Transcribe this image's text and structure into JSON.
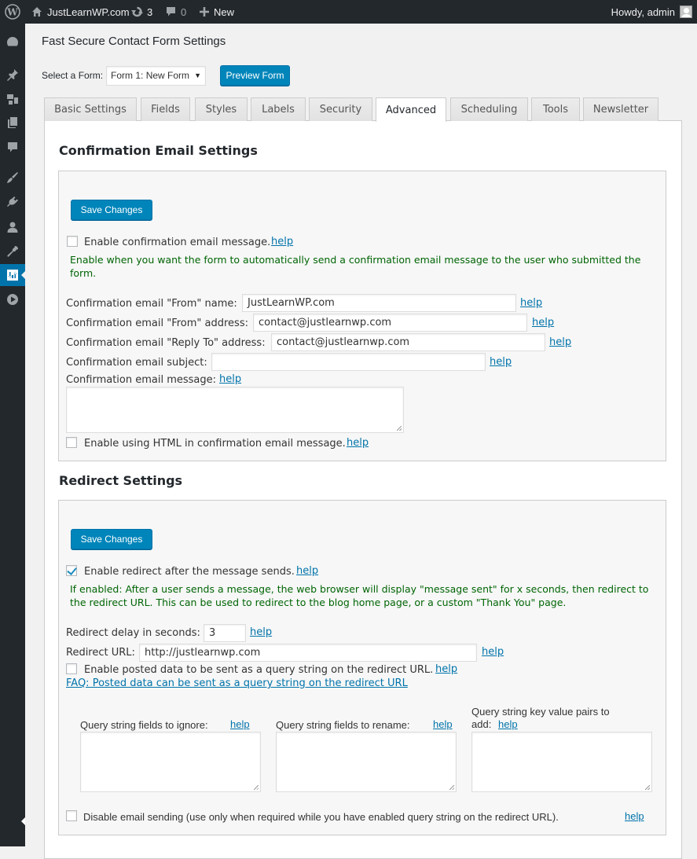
{
  "admin_bar": {
    "site_name": "JustLearnWP.com",
    "updates_count": "3",
    "comments_count": "0",
    "new_label": "New",
    "howdy": "Howdy, admin"
  },
  "sidebar": {
    "items": [
      {
        "icon": "dashboard-icon"
      },
      {
        "icon": "posts-pin-icon"
      },
      {
        "icon": "media-icon"
      },
      {
        "icon": "pages-icon"
      },
      {
        "icon": "comments-icon"
      },
      {
        "icon": "appearance-brush-icon"
      },
      {
        "icon": "plugins-icon"
      },
      {
        "icon": "users-icon"
      },
      {
        "icon": "tools-wrench-icon"
      },
      {
        "icon": "settings-sliders-icon",
        "active": true
      },
      {
        "icon": "play-circle-icon"
      }
    ]
  },
  "page": {
    "title": "Fast Secure Contact Form Settings",
    "select_label": "Select a Form:",
    "select_value": "Form 1: New Form",
    "preview_button": "Preview Form"
  },
  "tabs": [
    {
      "label": "Basic Settings"
    },
    {
      "label": "Fields"
    },
    {
      "label": "Styles"
    },
    {
      "label": "Labels"
    },
    {
      "label": "Security"
    },
    {
      "label": "Advanced",
      "active": true
    },
    {
      "label": "Scheduling"
    },
    {
      "label": "Tools"
    },
    {
      "label": "Newsletter"
    }
  ],
  "confirmation": {
    "title": "Confirmation Email Settings",
    "save_button": "Save Changes",
    "enable_label": "Enable confirmation email message.",
    "enable_checked": false,
    "enable_description": "Enable when you want the form to automatically send a confirmation email message to the user who submitted the form.",
    "from_name_label": "Confirmation email \"From\" name:",
    "from_name_value": "JustLearnWP.com",
    "from_address_label": "Confirmation email \"From\" address:",
    "from_address_value": "contact@justlearnwp.com",
    "reply_to_label": "Confirmation email \"Reply To\" address:",
    "reply_to_value": "contact@justlearnwp.com",
    "subject_label": "Confirmation email subject:",
    "subject_value": "",
    "message_label": "Confirmation email message:",
    "message_value": "",
    "html_label": "Enable using HTML in confirmation email message.",
    "html_checked": false,
    "help": "help"
  },
  "redirect": {
    "title": "Redirect Settings",
    "save_button": "Save Changes",
    "enable_label": "Enable redirect after the message sends.",
    "enable_checked": true,
    "enable_description": "If enabled: After a user sends a message, the web browser will display \"message sent\" for x seconds, then redirect to the redirect URL. This can be used to redirect to the blog home page, or a custom \"Thank You\" page.",
    "delay_label": "Redirect delay in seconds:",
    "delay_value": "3",
    "url_label": "Redirect URL:",
    "url_value": "http://justlearnwp.com",
    "query_label": "Enable posted data to be sent as a query string on the redirect URL.",
    "query_checked": false,
    "faq_link": "FAQ: Posted data can be sent as a query string on the redirect URL",
    "ignore_label": "Query string fields to ignore:",
    "rename_label": "Query string fields to rename:",
    "add_label_line1": "Query string key value pairs to",
    "add_label_line2": "add:",
    "disable_label": "Disable email sending (use only when required while you have enabled query string on the redirect URL).",
    "disable_checked": false,
    "help": "help"
  }
}
